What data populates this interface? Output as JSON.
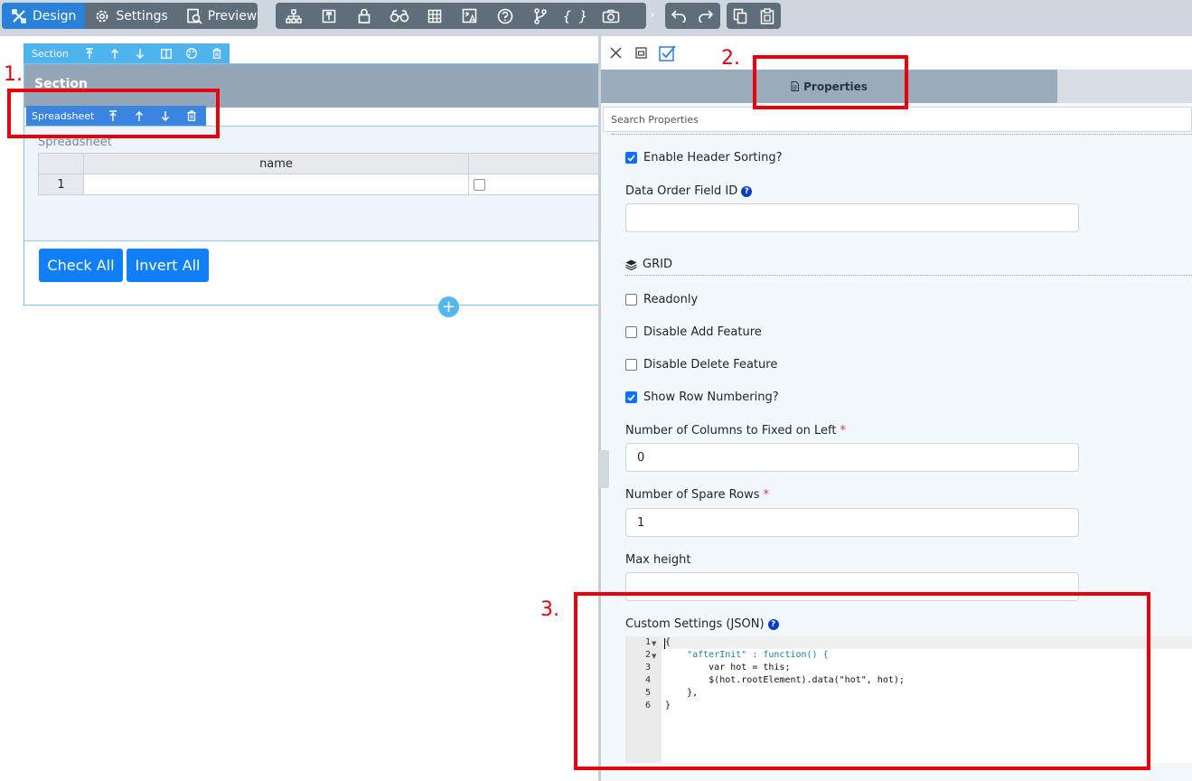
{
  "toolbar": {
    "design_label": "Design",
    "settings_label": "Settings",
    "preview_label": "Preview",
    "tool_icons": [
      "sitemap-icon",
      "upload-box-icon",
      "lock-icon",
      "binoculars-icon",
      "grid-icon",
      "translate-icon",
      "help-circle-icon",
      "branch-icon",
      "braces-icon",
      "camera-icon"
    ],
    "undo_icon": "undo-icon",
    "redo_icon": "redo-icon",
    "copy_icon": "copy-icon",
    "paste_icon": "paste-icon"
  },
  "canvas": {
    "section_toolbar_label": "Section",
    "section_title": "Section",
    "spreadsheet_toolbar_label": "Spreadsheet",
    "spreadsheet_label": "Spreadsheet",
    "grid": {
      "column_header": "name",
      "row_number": "1"
    },
    "check_all_label": "Check All",
    "invert_all_label": "Invert All",
    "add_icon": "+"
  },
  "panel": {
    "tab_label": "Properties",
    "search_placeholder": "Search Properties",
    "enable_header_sorting": {
      "label": "Enable Header Sorting?",
      "checked": true
    },
    "data_order_field_id": {
      "label": "Data Order Field ID",
      "value": ""
    },
    "grid_section_title": "GRID",
    "readonly": {
      "label": "Readonly",
      "checked": false
    },
    "disable_add": {
      "label": "Disable Add Feature",
      "checked": false
    },
    "disable_delete": {
      "label": "Disable Delete Feature",
      "checked": false
    },
    "show_row_numbering": {
      "label": "Show Row Numbering?",
      "checked": true
    },
    "fixed_columns": {
      "label": "Number of Columns to Fixed on Left",
      "required_mark": "*",
      "value": "0"
    },
    "spare_rows": {
      "label": "Number of Spare Rows",
      "required_mark": "*",
      "value": "1"
    },
    "max_height": {
      "label": "Max height",
      "value": ""
    },
    "custom_settings": {
      "label": "Custom Settings (JSON)",
      "line_numbers": [
        "1",
        "2",
        "3",
        "4",
        "5",
        "6"
      ],
      "lines": [
        "{",
        "    \"afterInit\" : function() {",
        "        var hot = this;",
        "        $(hot.rootElement).data(\"hot\", hot);",
        "    },",
        "}"
      ]
    }
  },
  "annotations": {
    "one": "1.",
    "two": "2.",
    "three": "3."
  },
  "colors": {
    "toolbar_bg": "#5f6e7a",
    "accent": "#2a82d8",
    "button_blue": "#1180f8",
    "annotation_red": "#e8000b"
  }
}
